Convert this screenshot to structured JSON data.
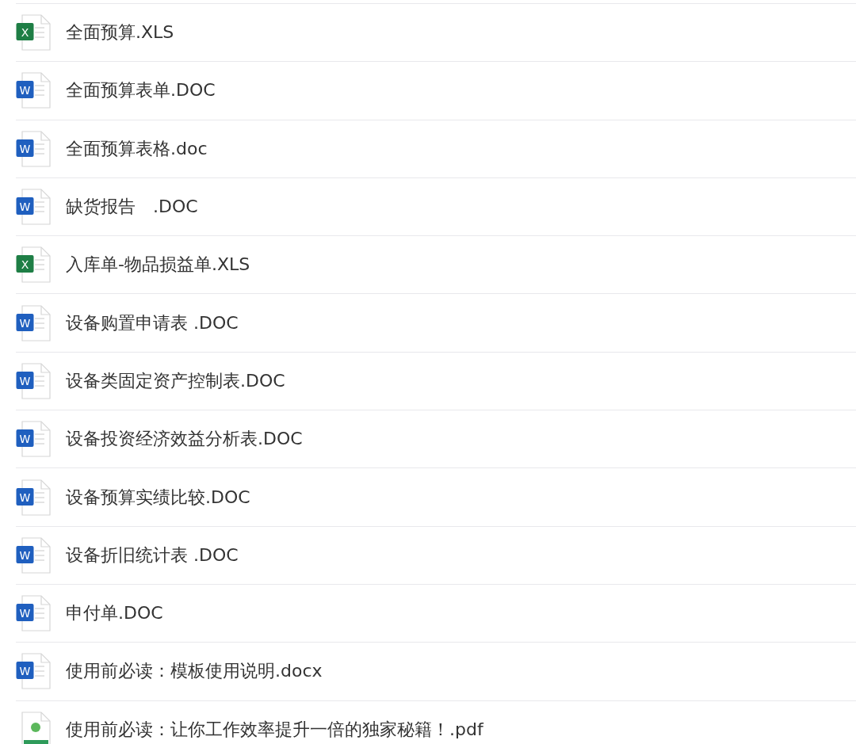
{
  "files": [
    {
      "kind": "xls",
      "name": "全面预算.XLS",
      "badge": "X"
    },
    {
      "kind": "doc",
      "name": "全面预算表单.DOC",
      "badge": "W"
    },
    {
      "kind": "doc",
      "name": "全面预算表格.doc",
      "badge": "W"
    },
    {
      "kind": "doc",
      "name": "缺货报告　.DOC",
      "badge": "W"
    },
    {
      "kind": "xls",
      "name": "入库单-物品损益单.XLS",
      "badge": "X"
    },
    {
      "kind": "doc",
      "name": "设备购置申请表 .DOC",
      "badge": "W"
    },
    {
      "kind": "doc",
      "name": "设备类固定资产控制表.DOC",
      "badge": "W"
    },
    {
      "kind": "doc",
      "name": "设备投资经济效益分析表.DOC",
      "badge": "W"
    },
    {
      "kind": "doc",
      "name": "设备预算实绩比较.DOC",
      "badge": "W"
    },
    {
      "kind": "doc",
      "name": "设备折旧统计表 .DOC",
      "badge": "W"
    },
    {
      "kind": "doc",
      "name": "申付单.DOC",
      "badge": "W"
    },
    {
      "kind": "doc",
      "name": "使用前必读：模板使用说明.docx",
      "badge": "W"
    },
    {
      "kind": "thumb",
      "name": "使用前必读：让你工作效率提升一倍的独家秘籍！.pdf"
    }
  ]
}
